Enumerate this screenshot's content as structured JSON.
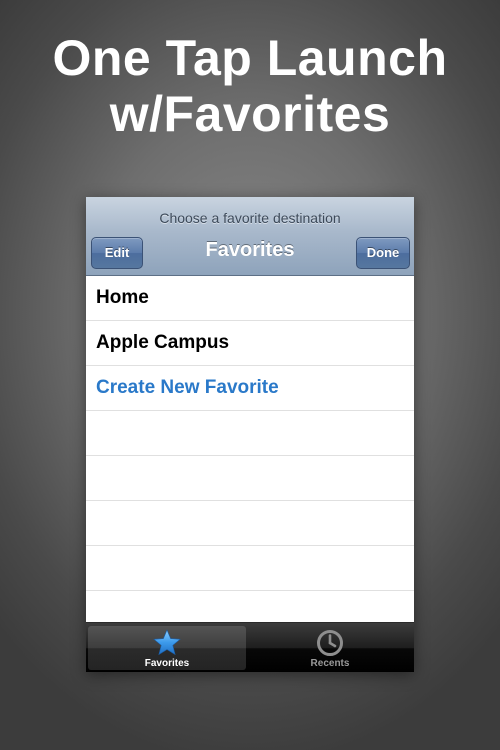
{
  "headline": {
    "line1": "One Tap Launch",
    "line2": "w/Favorites"
  },
  "navbar": {
    "prompt": "Choose a favorite destination",
    "title": "Favorites",
    "edit_label": "Edit",
    "done_label": "Done"
  },
  "list": {
    "items": [
      {
        "label": "Home"
      },
      {
        "label": "Apple Campus"
      },
      {
        "label": "Create New Favorite"
      },
      {
        "label": ""
      },
      {
        "label": ""
      },
      {
        "label": ""
      },
      {
        "label": ""
      },
      {
        "label": ""
      }
    ]
  },
  "tabbar": {
    "tabs": [
      {
        "label": "Favorites",
        "icon": "star-icon",
        "active": true
      },
      {
        "label": "Recents",
        "icon": "clock-icon",
        "active": false
      }
    ]
  },
  "colors": {
    "accent_blue": "#2a79c9",
    "nav_button": "#5c7cab",
    "star_blue": "#4aa3f0"
  }
}
